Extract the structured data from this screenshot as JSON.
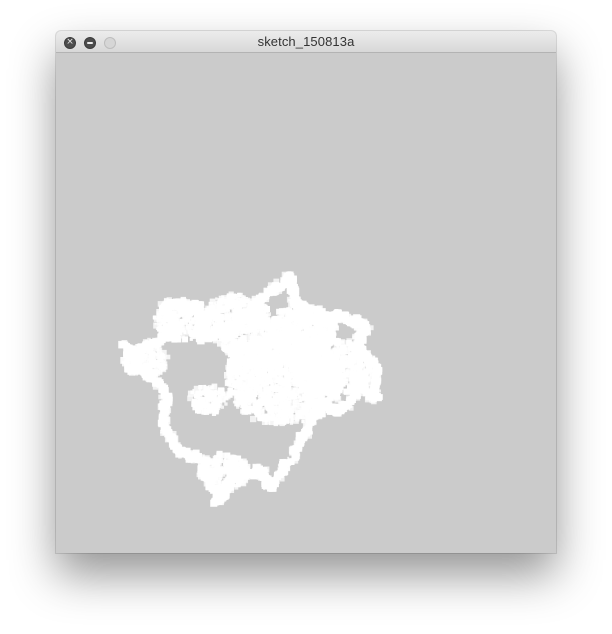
{
  "window": {
    "title": "sketch_150813a",
    "canvas_background": "#cbcbcb",
    "shape_color": "#ffffff"
  },
  "controls": {
    "close_icon": "close-icon",
    "minimize_icon": "minimize-icon",
    "zoom_icon": "zoom-icon"
  }
}
